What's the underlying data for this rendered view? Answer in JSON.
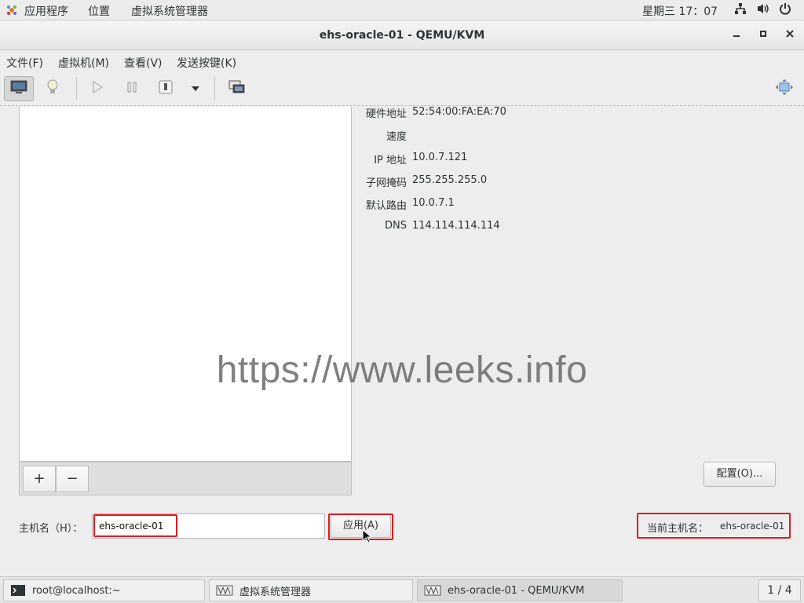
{
  "topbar": {
    "apps_label": "应用程序",
    "places_label": "位置",
    "app_label": "虚拟系统管理器",
    "clock": "星期三 17：07",
    "tray_icons": [
      "network-icon",
      "volume-icon",
      "power-icon"
    ]
  },
  "window": {
    "title": "ehs-oracle-01 - QEMU/KVM",
    "controls": [
      "minimize",
      "maximize",
      "close"
    ]
  },
  "menubar": {
    "file": "文件(F)",
    "vm": "虚拟机(M)",
    "view": "查看(V)",
    "sendkey": "发送按键(K)"
  },
  "toolbar": {
    "buttons": [
      "console-icon",
      "details-bulb-icon",
      "run-icon",
      "pause-icon",
      "shutdown-icon",
      "dropdown-icon",
      "snapshots-icon",
      "resize-icon"
    ]
  },
  "network_info": {
    "hw_label": "硬件地址",
    "hw_value": "52:54:00:FA:EA:70",
    "speed_label": "速度",
    "speed_value": "",
    "ip_label": "IP 地址",
    "ip_value": "10.0.7.121",
    "mask_label": "子网掩码",
    "mask_value": "255.255.255.0",
    "gw_label": "默认路由",
    "gw_value": "10.0.7.1",
    "dns_label": "DNS",
    "dns_value": "114.114.114.114"
  },
  "list_toolbar": {
    "add_label": "+",
    "remove_label": "−"
  },
  "configure_button": "配置(O)...",
  "hostname": {
    "label": "主机名（H）：",
    "value": "ehs-oracle-01",
    "apply_label": "应用(A)",
    "current_label": "当前主机名：",
    "current_value": "ehs-oracle-01"
  },
  "watermark": "https://www.leeks.info",
  "taskbar": {
    "items": [
      {
        "label": "root@localhost:~"
      },
      {
        "label": "虚拟系统管理器"
      },
      {
        "label": "ehs-oracle-01 - QEMU/KVM"
      }
    ],
    "pager": "1 / 4"
  },
  "colors": {
    "highlight_red": "#e3191e",
    "background": "#ededed"
  }
}
